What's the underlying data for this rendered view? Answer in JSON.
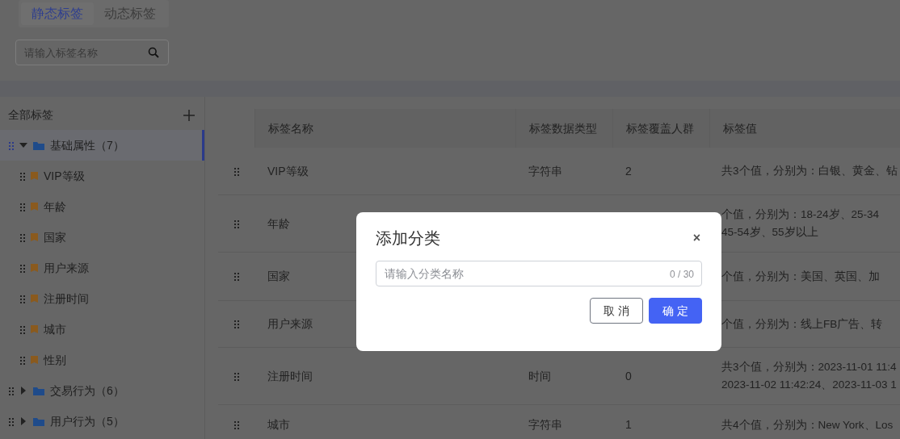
{
  "tabs": [
    {
      "label": "静态标签",
      "selected": true
    },
    {
      "label": "动态标签",
      "selected": false
    }
  ],
  "search": {
    "placeholder": "请输入标签名称"
  },
  "sidebar": {
    "title": "全部标签",
    "tree": [
      {
        "kind": "folder",
        "label": "基础属性（7）",
        "expanded": true,
        "selected": true,
        "children": [
          {
            "kind": "tag",
            "label": "VIP等级",
            "selected": false
          },
          {
            "kind": "tag",
            "label": "年龄",
            "selected": false
          },
          {
            "kind": "tag",
            "label": "国家",
            "selected": false
          },
          {
            "kind": "tag",
            "label": "用户来源",
            "selected": false
          },
          {
            "kind": "tag",
            "label": "注册时间",
            "selected": false
          },
          {
            "kind": "tag",
            "label": "城市",
            "selected": false
          },
          {
            "kind": "tag",
            "label": "性别",
            "selected": false
          }
        ]
      },
      {
        "kind": "folder",
        "label": "交易行为（6）",
        "expanded": false,
        "selected": false
      },
      {
        "kind": "folder",
        "label": "用户行为（5）",
        "expanded": false,
        "selected": false
      }
    ]
  },
  "table": {
    "columns": [
      "标签名称",
      "标签数据类型",
      "标签覆盖人群",
      "标签值"
    ],
    "rows": [
      {
        "name": "VIP等级",
        "type": "字符串",
        "count": "2",
        "values": [
          "共3个值，分别为：白银、黄金、钻"
        ]
      },
      {
        "name": "年龄",
        "values": [
          "个值，分别为：18-24岁、25-34",
          "45-54岁、55岁以上"
        ]
      },
      {
        "name": "国家",
        "values": [
          "个值，分别为：美国、英国、加"
        ]
      },
      {
        "name": "用户来源",
        "values": [
          "个值，分别为：线上FB广告、转"
        ]
      },
      {
        "name": "注册时间",
        "type": "时间",
        "count": "0",
        "values": [
          "共3个值，分别为：2023-11-01 11:4",
          "2023-11-02 11:42:24、2023-11-03 1"
        ]
      },
      {
        "name": "城市",
        "type": "字符串",
        "count": "1",
        "values": [
          "共4个值，分别为：New York、Los"
        ]
      }
    ]
  },
  "dialog": {
    "title": "添加分类",
    "close": "×",
    "placeholder": "请输入分类名称",
    "counter": "0 / 30",
    "buttons": [
      {
        "kind": "secondary",
        "label": "取 消"
      },
      {
        "kind": "primary",
        "label": "确 定"
      }
    ]
  }
}
